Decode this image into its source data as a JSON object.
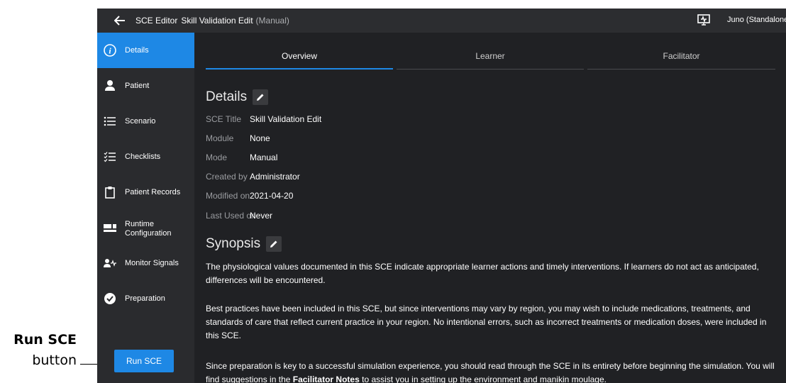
{
  "callout": {
    "title": "Run SCE",
    "subtitle": "button"
  },
  "titlebar": {
    "app_name": "SCE Editor",
    "sce_name": "Skill Validation Edit",
    "sce_mode": "(Manual)",
    "device_name": "Juno (Standalone)"
  },
  "sidebar": {
    "items": [
      {
        "label": "Details",
        "icon": "info-icon",
        "active": true
      },
      {
        "label": "Patient",
        "icon": "person-icon"
      },
      {
        "label": "Scenario",
        "icon": "list-icon"
      },
      {
        "label": "Checklists",
        "icon": "checklist-icon"
      },
      {
        "label": "Patient Records",
        "icon": "clipboard-icon"
      },
      {
        "label_line1": "Runtime",
        "label_line2": "Configuration",
        "icon": "layout-icon"
      },
      {
        "label": "Monitor Signals",
        "icon": "person-signal-icon"
      },
      {
        "label": "Preparation",
        "icon": "check-circle-icon"
      }
    ],
    "run_button_label": "Run SCE"
  },
  "tabs": [
    {
      "label": "Overview",
      "active": true
    },
    {
      "label": "Learner"
    },
    {
      "label": "Facilitator"
    }
  ],
  "details": {
    "title": "Details",
    "rows": [
      {
        "label": "SCE Title",
        "value": "Skill Validation Edit"
      },
      {
        "label": "Module",
        "value": "None"
      },
      {
        "label": "Mode",
        "value": "Manual"
      },
      {
        "label": "Created by",
        "value": "Administrator"
      },
      {
        "label": "Modified on",
        "value": "2021-04-20"
      },
      {
        "label": "Last Used on",
        "value": "Never"
      }
    ]
  },
  "synopsis": {
    "title": "Synopsis",
    "paragraph1": "The physiological values documented in this SCE indicate appropriate learner actions and timely interventions. If learners do not act as anticipated, differences will be encountered.",
    "paragraph2": "Best practices have been included in this SCE, but since interventions may vary by region, you may wish to include medications, treatments, and standards of care that reflect current practice in your region. No intentional errors, such as incorrect treatments or medication doses, were included in this SCE.",
    "paragraph3_part1": "Since preparation is key to a successful simulation experience, you should read through the SCE in its entirety before beginning the simulation. You will find suggestions in the ",
    "paragraph3_bold": "Facilitator Notes",
    "paragraph3_part2": " to assist you in setting up the environment and manikin moulage."
  },
  "colors": {
    "accent": "#1e88e5",
    "background": "#202124",
    "sidebar": "#2a2b2e"
  }
}
